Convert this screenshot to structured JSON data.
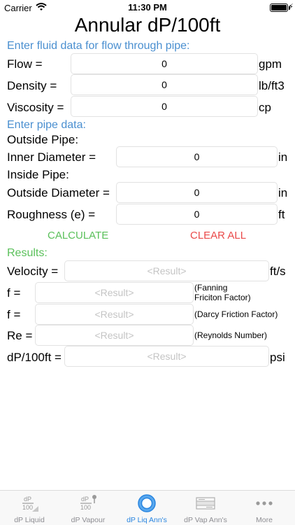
{
  "status_bar": {
    "carrier": "Carrier",
    "time": "11:30 PM"
  },
  "title": "Annular dP/100ft",
  "fluid_section": {
    "heading": "Enter fluid data for flow through pipe:",
    "flow": {
      "label": "Flow =",
      "value": "0",
      "unit": "gpm"
    },
    "density": {
      "label": "Density =",
      "value": "0",
      "unit": "lb/ft3"
    },
    "viscosity": {
      "label": "Viscosity =",
      "value": "0",
      "unit": "cp"
    }
  },
  "pipe_section": {
    "heading": "Enter pipe data:",
    "outside_pipe_label": "Outside Pipe:",
    "inner_diameter": {
      "label": "Inner Diameter =",
      "value": "0",
      "unit": "in"
    },
    "inside_pipe_label": "Inside Pipe:",
    "outside_diameter": {
      "label": "Outside Diameter =",
      "value": "0",
      "unit": "in"
    },
    "roughness": {
      "label": "Roughness (e) =",
      "value": "0",
      "unit": "ft"
    }
  },
  "actions": {
    "calculate": "CALCULATE",
    "clear_all": "CLEAR ALL"
  },
  "results": {
    "heading": "Results:",
    "placeholder": "<Result>",
    "velocity": {
      "label": "Velocity =",
      "unit": "ft/s"
    },
    "fanning": {
      "label": "f =",
      "note_line1": "(Fanning",
      "note_line2": "Friciton Factor)"
    },
    "darcy": {
      "label": "f =",
      "note": "(Darcy Friction Factor)"
    },
    "reynolds": {
      "label": "Re =",
      "note": "(Reynolds Number)"
    },
    "dp": {
      "label": "dP/100ft =",
      "unit": "psi"
    }
  },
  "tabs": [
    {
      "label": "dP Liquid",
      "icon": "dp-liquid-icon",
      "active": false
    },
    {
      "label": "dP Vapour",
      "icon": "dp-vapour-icon",
      "active": false
    },
    {
      "label": "dP Liq Ann's",
      "icon": "annulus-liquid-icon",
      "active": true
    },
    {
      "label": "dP Vap Ann's",
      "icon": "annulus-vapour-icon",
      "active": false
    },
    {
      "label": "More",
      "icon": "more-icon",
      "active": false
    }
  ],
  "colors": {
    "section_blue": "#4a8fd0",
    "results_green": "#5ac05a",
    "clear_red": "#ea4a4a",
    "tab_active": "#2a86e0"
  }
}
